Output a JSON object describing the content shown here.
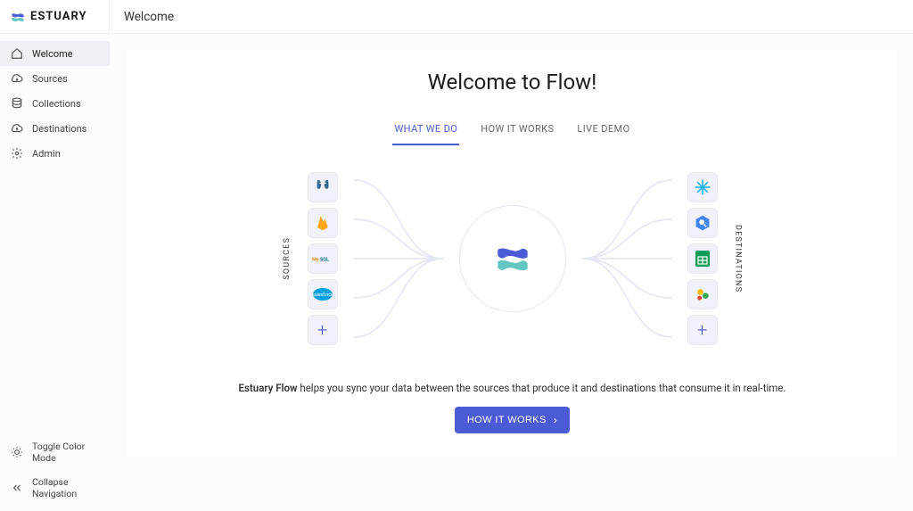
{
  "header": {
    "brand": "ESTUARY",
    "page_title": "Welcome"
  },
  "sidebar": {
    "items": [
      {
        "label": "Welcome",
        "icon": "home-icon",
        "active": true
      },
      {
        "label": "Sources",
        "icon": "cloud-down-icon",
        "active": false
      },
      {
        "label": "Collections",
        "icon": "database-icon",
        "active": false
      },
      {
        "label": "Destinations",
        "icon": "cloud-up-icon",
        "active": false
      },
      {
        "label": "Admin",
        "icon": "gear-icon",
        "active": false
      }
    ],
    "bottom": [
      {
        "label": "Toggle Color Mode",
        "icon": "sun-icon"
      },
      {
        "label": "Collapse Navigation",
        "icon": "chevrons-left-icon"
      }
    ]
  },
  "hero": {
    "title": "Welcome to Flow!",
    "tabs": [
      {
        "label": "WHAT WE DO",
        "active": true
      },
      {
        "label": "HOW IT WORKS",
        "active": false
      },
      {
        "label": "LIVE DEMO",
        "active": false
      }
    ],
    "diagram": {
      "left_label": "SOURCES",
      "right_label": "DESTINATIONS",
      "sources": [
        "postgresql-icon",
        "firebase-icon",
        "mysql-icon",
        "salesforce-icon",
        "plus-icon"
      ],
      "destinations": [
        "snowflake-icon",
        "bigquery-icon",
        "google-sheets-icon",
        "looker-icon",
        "plus-icon"
      ]
    },
    "blurb_lead": "Estuary Flow",
    "blurb_rest": " helps you sync your data between the sources that produce it and destinations that consume it in real-time.",
    "cta_label": "HOW IT WORKS"
  }
}
